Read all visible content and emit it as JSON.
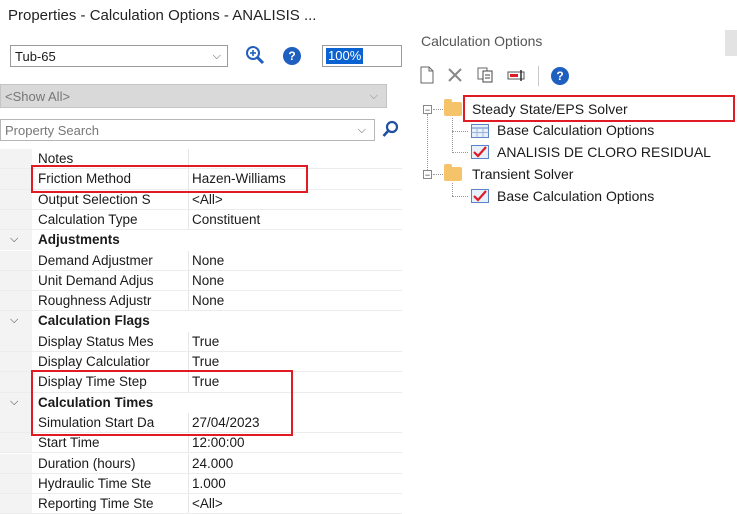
{
  "properties_panel": {
    "title": "Properties - Calculation Options - ANALISIS ...",
    "element_select_value": "Tub-65",
    "zoom_value": "100%",
    "filter_select_value": "<Show All>",
    "search_placeholder": "Property Search",
    "rows": [
      {
        "type": "prop",
        "name": "Notes",
        "value": ""
      },
      {
        "type": "prop",
        "name": "Friction Method",
        "value": "Hazen-Williams"
      },
      {
        "type": "prop",
        "name": "Output Selection S",
        "value": "<All>"
      },
      {
        "type": "prop",
        "name": "Calculation Type",
        "value": "Constituent"
      },
      {
        "type": "category",
        "name": "Adjustments"
      },
      {
        "type": "prop",
        "name": "Demand Adjustmer",
        "value": "None"
      },
      {
        "type": "prop",
        "name": "Unit Demand Adjus",
        "value": "None"
      },
      {
        "type": "prop",
        "name": "Roughness Adjustr",
        "value": "None"
      },
      {
        "type": "category",
        "name": "Calculation Flags"
      },
      {
        "type": "prop",
        "name": "Display Status Mes",
        "value": "True"
      },
      {
        "type": "prop",
        "name": "Display Calculatior",
        "value": "True"
      },
      {
        "type": "prop",
        "name": "Display Time Step",
        "value": "True"
      },
      {
        "type": "category",
        "name": "Calculation Times"
      },
      {
        "type": "prop",
        "name": "Simulation Start Da",
        "value": "27/04/2023"
      },
      {
        "type": "prop",
        "name": "Start Time",
        "value": "12:00:00"
      },
      {
        "type": "prop",
        "name": "Duration (hours)",
        "value": "24.000"
      },
      {
        "type": "prop",
        "name": "Hydraulic Time Ste",
        "value": "1.000"
      },
      {
        "type": "prop",
        "name": "Reporting Time Ste",
        "value": "<All>"
      }
    ]
  },
  "calculation_options": {
    "title": "Calculation Options",
    "toolbar": [
      "new-icon",
      "delete-icon",
      "duplicate-icon",
      "rename-icon",
      "help-icon"
    ],
    "tree": {
      "steady_state": "Steady State/EPS Solver",
      "base_calc_1": "Base Calculation Options",
      "analisis": "ANALISIS DE CLORO RESIDUAL",
      "transient": "Transient Solver",
      "base_calc_2": "Base Calculation Options"
    }
  },
  "colors": {
    "highlight": "#e01b24",
    "accent": "#1f5fbf",
    "selection": "#0a63d1"
  }
}
